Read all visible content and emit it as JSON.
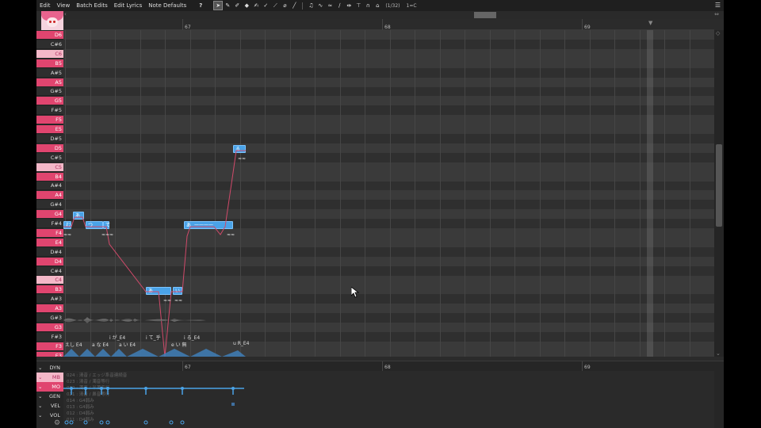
{
  "menubar": {
    "items": [
      "Edit",
      "View",
      "Batch Edits",
      "Edit Lyrics",
      "Note Defaults"
    ],
    "help": "?",
    "page": "(1/32)",
    "key": "1=C",
    "options_icon": "menu-lines-icon"
  },
  "ruler": {
    "bars": [
      "67",
      "68",
      "69"
    ]
  },
  "keys": [
    {
      "label": "D6",
      "type": "white"
    },
    {
      "label": "C#6",
      "type": "black"
    },
    {
      "label": "C6",
      "type": "light"
    },
    {
      "label": "B5",
      "type": "white"
    },
    {
      "label": "A#5",
      "type": "black"
    },
    {
      "label": "A5",
      "type": "white"
    },
    {
      "label": "G#5",
      "type": "black"
    },
    {
      "label": "G5",
      "type": "white"
    },
    {
      "label": "F#5",
      "type": "black"
    },
    {
      "label": "F5",
      "type": "white"
    },
    {
      "label": "E5",
      "type": "white"
    },
    {
      "label": "D#5",
      "type": "black"
    },
    {
      "label": "D5",
      "type": "white"
    },
    {
      "label": "C#5",
      "type": "black"
    },
    {
      "label": "C5",
      "type": "light"
    },
    {
      "label": "B4",
      "type": "white"
    },
    {
      "label": "A#4",
      "type": "black"
    },
    {
      "label": "A4",
      "type": "white"
    },
    {
      "label": "G#4",
      "type": "black"
    },
    {
      "label": "G4",
      "type": "white"
    },
    {
      "label": "F#4",
      "type": "black"
    },
    {
      "label": "F4",
      "type": "white"
    },
    {
      "label": "E4",
      "type": "white"
    },
    {
      "label": "D#4",
      "type": "black"
    },
    {
      "label": "D4",
      "type": "white"
    },
    {
      "label": "C#4",
      "type": "black"
    },
    {
      "label": "C4",
      "type": "light"
    },
    {
      "label": "B3",
      "type": "white"
    },
    {
      "label": "A#3",
      "type": "black"
    },
    {
      "label": "A3",
      "type": "white"
    },
    {
      "label": "G#3",
      "type": "black"
    },
    {
      "label": "G3",
      "type": "white"
    },
    {
      "label": "F#3",
      "type": "black"
    },
    {
      "label": "F3",
      "type": "white"
    },
    {
      "label": "E3",
      "type": "white"
    }
  ],
  "notes": [
    {
      "label": "む",
      "tail": ""
    },
    {
      "label": "あ",
      "tail": ""
    },
    {
      "label": "つ",
      "tail": "——"
    },
    {
      "label": "て",
      "tail": ""
    },
    {
      "label": "あ",
      "tail": ""
    },
    {
      "label": "い",
      "tail": ""
    },
    {
      "label": "あ",
      "tail": "————"
    },
    {
      "label": "る",
      "tail": ""
    }
  ],
  "phonemes": [
    "i が_E4",
    "i て_乎",
    "i る_E4",
    "えし E4",
    "a な E4",
    "a い E4",
    "e い 無",
    "u R_E4"
  ],
  "expression": {
    "labels": [
      "DYN",
      "MB",
      "MO",
      "GEN",
      "VEL",
      "VOL"
    ],
    "bars": [
      "67",
      "68",
      "69"
    ],
    "items": [
      "024 : 清音 / エッジ系音連続音",
      "023 : 清音 / 濁音等行",
      "022 : 濁音 / 半濁音行",
      "021 : 清音 / 鼻音等行",
      "014 : G4弱み",
      "013 : G4弱み",
      "012 : D4弱み",
      "011 : D4弱み"
    ]
  },
  "colors": {
    "key_pink": "#e0456f",
    "key_light": "#f4b8c8",
    "note_blue": "#4aa3e8",
    "pitch_curve": "#d04a6a"
  }
}
